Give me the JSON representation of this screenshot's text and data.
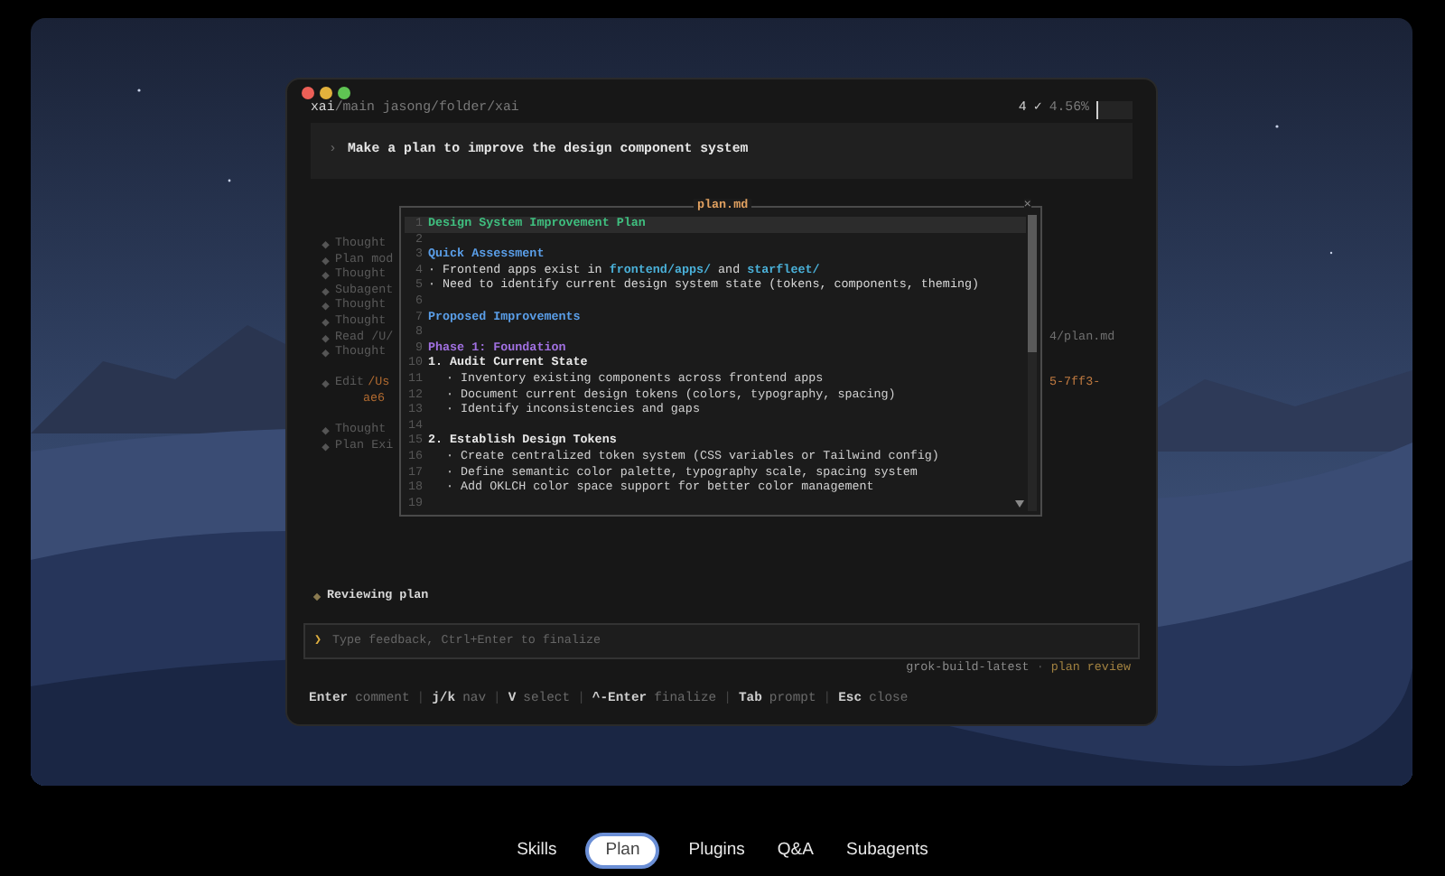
{
  "terminal": {
    "branch": "xai",
    "path": "/main jasong/folder/xai",
    "status_count": "4",
    "status_check": "✓",
    "status_percent": "4.56%",
    "prompt": {
      "chevron": "›",
      "text": "Make a plan to improve the design component system"
    },
    "timeline": [
      {
        "kind": "entry",
        "label": "Thought"
      },
      {
        "kind": "entry",
        "label": "Plan mod"
      },
      {
        "kind": "entry",
        "label": "Thought"
      },
      {
        "kind": "entry",
        "label": "Subagent"
      },
      {
        "kind": "entry",
        "label": "Thought"
      },
      {
        "kind": "entry",
        "label": "Thought"
      },
      {
        "kind": "entry",
        "label": "Read /U/",
        "tail": "4/plan.md"
      },
      {
        "kind": "entry",
        "label": "Thought"
      },
      {
        "kind": "gap"
      },
      {
        "kind": "entry",
        "label": "Edit",
        "path": "/Us",
        "tail": "5-7ff3-"
      },
      {
        "kind": "wrap",
        "path": "ae6"
      },
      {
        "kind": "gap"
      },
      {
        "kind": "entry",
        "label": "Thought"
      },
      {
        "kind": "entry",
        "label": "Plan Exi"
      }
    ],
    "status_line": "Reviewing plan",
    "feedback": {
      "chevron": "❯",
      "placeholder": "Type feedback, Ctrl+Enter to finalize"
    },
    "model": "grok-build-latest",
    "separator": "·",
    "mode": "plan review",
    "hints": [
      {
        "key": "Enter",
        "action": "comment"
      },
      {
        "key": "j/k",
        "action": "nav"
      },
      {
        "key": "V",
        "action": "select"
      },
      {
        "key": "^-Enter",
        "action": "finalize"
      },
      {
        "key": "Tab",
        "action": "prompt"
      },
      {
        "key": "Esc",
        "action": "close"
      }
    ],
    "hint_separator": "|"
  },
  "plan_popup": {
    "title": "plan.md",
    "close": "×",
    "lines": [
      {
        "num": "1",
        "kind": "title",
        "selected": true,
        "parts": [
          {
            "text": "Design System Improvement Plan"
          }
        ]
      },
      {
        "num": "2",
        "kind": "blank",
        "selected": false
      },
      {
        "num": "3",
        "kind": "heading",
        "selected": false,
        "parts": [
          {
            "text": "Quick Assessment"
          }
        ]
      },
      {
        "num": "4",
        "kind": "bullet",
        "selected": false,
        "parts": [
          {
            "text": "· Frontend apps exist in "
          },
          {
            "text": "frontend/apps/",
            "kind": "path"
          },
          {
            "text": " and "
          },
          {
            "text": "starfleet/",
            "kind": "path"
          }
        ]
      },
      {
        "num": "5",
        "kind": "bullet",
        "selected": false,
        "parts": [
          {
            "text": "· Need to identify current design system state (tokens, components, theming)"
          }
        ]
      },
      {
        "num": "6",
        "kind": "blank",
        "selected": false
      },
      {
        "num": "7",
        "kind": "heading",
        "selected": false,
        "parts": [
          {
            "text": "Proposed Improvements"
          }
        ]
      },
      {
        "num": "8",
        "kind": "blank",
        "selected": false
      },
      {
        "num": "9",
        "kind": "phase",
        "selected": false,
        "parts": [
          {
            "text": "Phase 1: Foundation"
          }
        ]
      },
      {
        "num": "10",
        "kind": "step",
        "selected": false,
        "parts": [
          {
            "text": "1. Audit Current State"
          }
        ]
      },
      {
        "num": "11",
        "kind": "sub",
        "selected": false,
        "parts": [
          {
            "text": "· Inventory existing components across frontend apps"
          }
        ]
      },
      {
        "num": "12",
        "kind": "sub",
        "selected": false,
        "parts": [
          {
            "text": "· Document current design tokens (colors, typography, spacing)"
          }
        ]
      },
      {
        "num": "13",
        "kind": "sub",
        "selected": false,
        "parts": [
          {
            "text": "· Identify inconsistencies and gaps"
          }
        ]
      },
      {
        "num": "14",
        "kind": "blank",
        "selected": false
      },
      {
        "num": "15",
        "kind": "step",
        "selected": false,
        "parts": [
          {
            "text": "2. Establish Design Tokens"
          }
        ]
      },
      {
        "num": "16",
        "kind": "sub",
        "selected": false,
        "parts": [
          {
            "text": "· Create centralized token system (CSS variables or Tailwind config)"
          }
        ]
      },
      {
        "num": "17",
        "kind": "sub",
        "selected": false,
        "parts": [
          {
            "text": "· Define semantic color palette, typography scale, spacing system"
          }
        ]
      },
      {
        "num": "18",
        "kind": "sub",
        "selected": false,
        "parts": [
          {
            "text": "· Add OKLCH color space support for better color management"
          }
        ]
      },
      {
        "num": "19",
        "kind": "blank",
        "selected": false
      }
    ]
  },
  "tabs": [
    {
      "label": "Skills",
      "selected": false
    },
    {
      "label": "Plan",
      "selected": true
    },
    {
      "label": "Plugins",
      "selected": false
    },
    {
      "label": "Q&A",
      "selected": false
    },
    {
      "label": "Subagents",
      "selected": false
    }
  ]
}
